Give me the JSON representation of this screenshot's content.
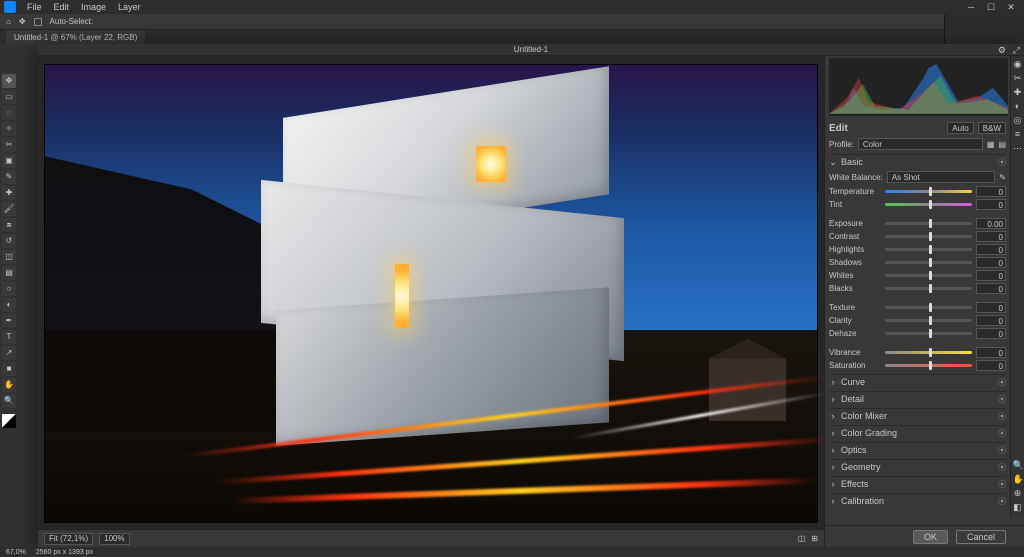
{
  "app": {
    "menus": [
      "File",
      "Edit",
      "Image",
      "Layer"
    ],
    "auto_select_label": "Auto-Select:",
    "doc_tab": "Untitled-1 @ 67% (Layer 22, RGB)",
    "status_zoom": "67,0%",
    "status_dim": "2560 px x 1393 px"
  },
  "cr": {
    "title": "Untitled-1",
    "zoom_fit": "Fit (72,1%)",
    "zoom_100": "100%",
    "ok": "OK",
    "cancel": "Cancel",
    "edit": {
      "title": "Edit",
      "auto": "Auto",
      "bw": "B&W",
      "profile_label": "Profile:",
      "profile_value": "Color"
    },
    "basic": {
      "title": "Basic",
      "wb_label": "White Balance:",
      "wb_value": "As Shot",
      "sliders": [
        {
          "label": "Temperature",
          "value": "0",
          "track": "temp",
          "pos": 50
        },
        {
          "label": "Tint",
          "value": "0",
          "track": "tint",
          "pos": 50
        }
      ],
      "tone": [
        {
          "label": "Exposure",
          "value": "0.00",
          "pos": 50
        },
        {
          "label": "Contrast",
          "value": "0",
          "pos": 50
        },
        {
          "label": "Highlights",
          "value": "0",
          "pos": 50
        },
        {
          "label": "Shadows",
          "value": "0",
          "pos": 50
        },
        {
          "label": "Whites",
          "value": "0",
          "pos": 50
        },
        {
          "label": "Blacks",
          "value": "0",
          "pos": 50
        }
      ],
      "presence": [
        {
          "label": "Texture",
          "value": "0",
          "pos": 50
        },
        {
          "label": "Clarity",
          "value": "0",
          "pos": 50
        },
        {
          "label": "Dehaze",
          "value": "0",
          "pos": 50
        }
      ],
      "color": [
        {
          "label": "Vibrance",
          "value": "0",
          "pos": 50,
          "track": "vib"
        },
        {
          "label": "Saturation",
          "value": "0",
          "pos": 50,
          "track": "sat"
        }
      ]
    },
    "sections": [
      "Curve",
      "Detail",
      "Color Mixer",
      "Color Grading",
      "Optics",
      "Geometry",
      "Effects",
      "Calibration"
    ]
  }
}
